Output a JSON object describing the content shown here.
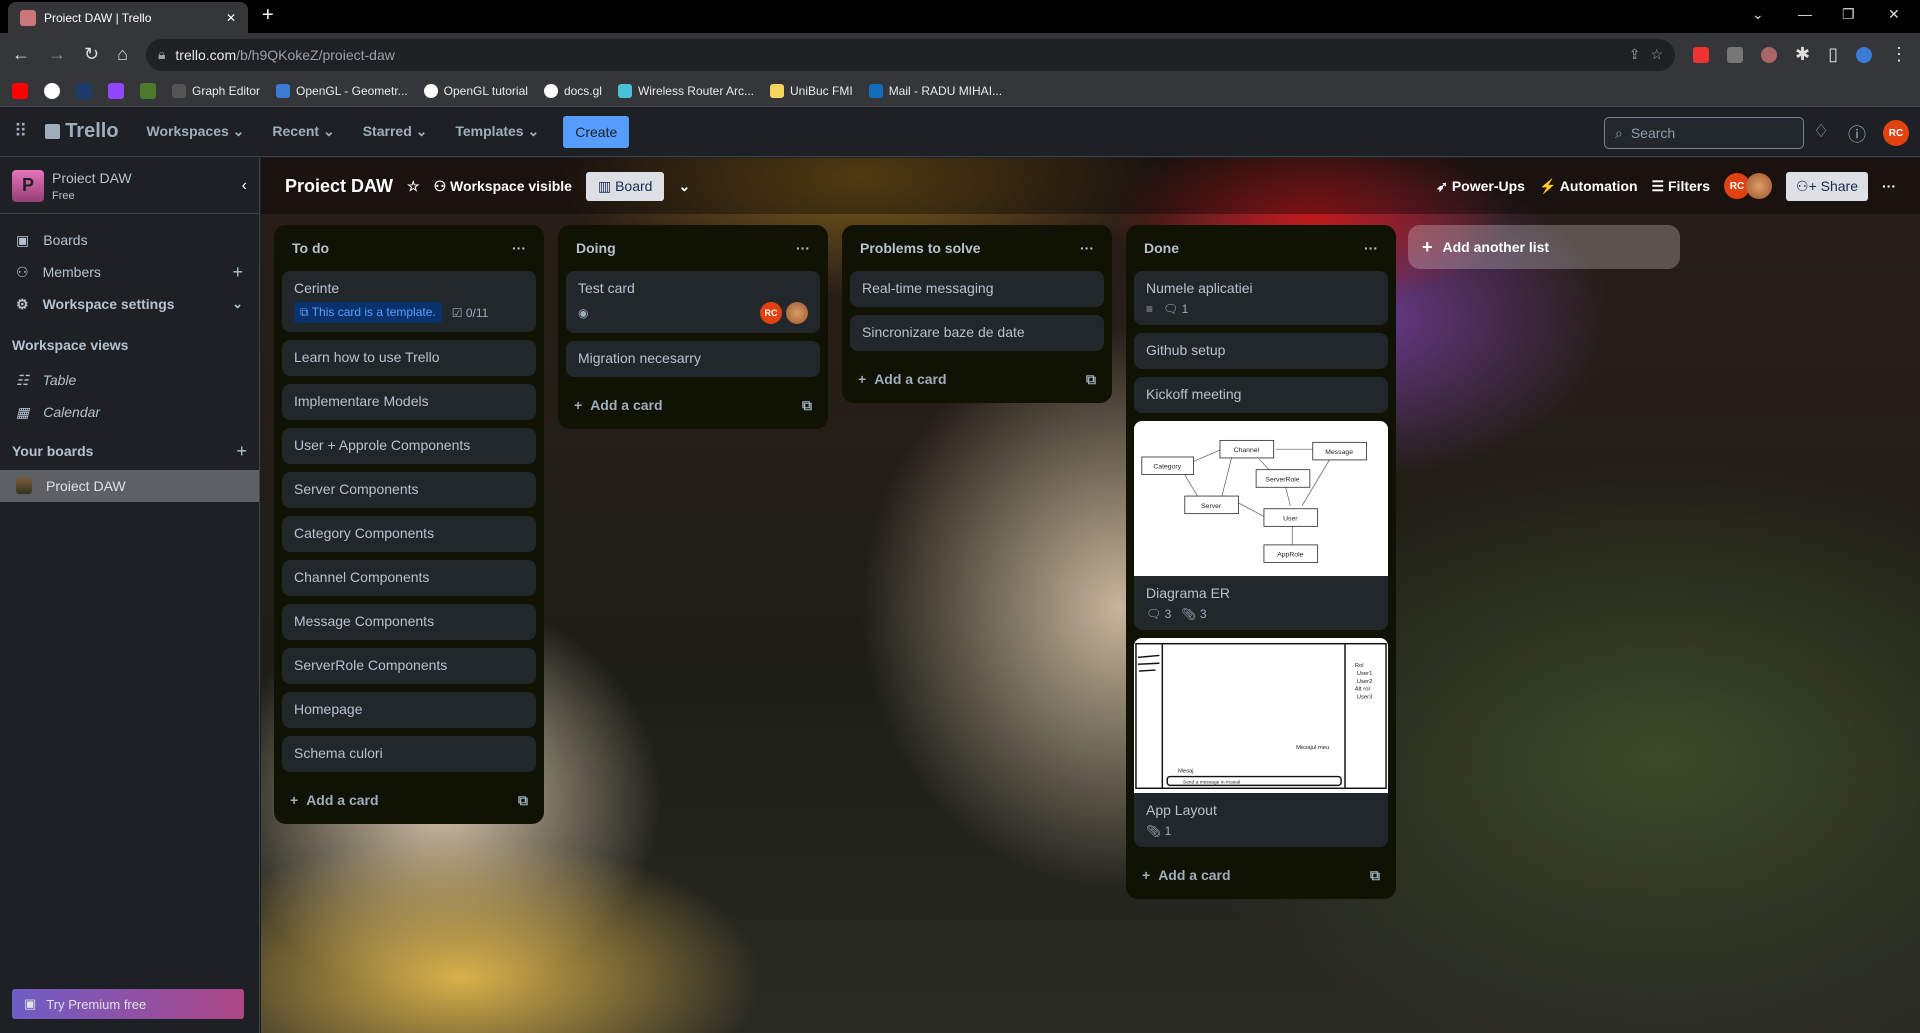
{
  "browser": {
    "tab_title": "Proiect DAW | Trello",
    "url_host": "trello.com",
    "url_path": "/b/h9QKokeZ/proiect-daw",
    "bookmarks": [
      "Graph Editor",
      "OpenGL - Geometr...",
      "OpenGL tutorial",
      "docs.gl",
      "Wireless Router Arc...",
      "UniBuc FMI",
      "Mail - RADU MIHAI..."
    ]
  },
  "header": {
    "logo": "Trello",
    "nav": [
      "Workspaces",
      "Recent",
      "Starred",
      "Templates"
    ],
    "create": "Create",
    "search_placeholder": "Search",
    "user_initials": "RC"
  },
  "sidebar": {
    "workspace_name": "Proiect DAW",
    "workspace_initial": "P",
    "plan": "Free",
    "items": [
      {
        "label": "Boards"
      },
      {
        "label": "Members"
      },
      {
        "label": "Workspace settings"
      }
    ],
    "views_heading": "Workspace views",
    "views": [
      {
        "label": "Table"
      },
      {
        "label": "Calendar"
      }
    ],
    "boards_heading": "Your boards",
    "boards": [
      {
        "label": "Proiect DAW"
      }
    ],
    "premium": "Try Premium free"
  },
  "board": {
    "title": "Proiect DAW",
    "visibility": "Workspace visible",
    "view": "Board",
    "powerups": "Power-Ups",
    "automation": "Automation",
    "filters": "Filters",
    "member_initials": "RC",
    "share": "Share",
    "add_list": "Add another list",
    "add_card": "Add a card"
  },
  "lists": [
    {
      "title": "To do",
      "cards": [
        "Cerinte",
        "Learn how to use Trello",
        "Implementare Models",
        "User + Approle Components",
        "Server Components",
        "Category Components",
        "Channel Components",
        "Message Components",
        "ServerRole Components",
        "Homepage",
        "Schema culori"
      ],
      "template_badge": "This card is a template.",
      "checklist": "0/11"
    },
    {
      "title": "Doing",
      "cards": [
        "Test card",
        "Migration necesarry"
      ],
      "test_initials": "RC"
    },
    {
      "title": "Problems to solve",
      "cards": [
        "Real-time messaging",
        "Sincronizare baze de date"
      ]
    },
    {
      "title": "Done",
      "cards": [
        "Numele aplicatiei",
        "Github setup",
        "Kickoff meeting",
        "Diagrama ER",
        "App Layout"
      ],
      "comments_1": "1",
      "er_comments": "3",
      "er_attachments": "3",
      "layout_attachments": "1",
      "er_entities": [
        "Category",
        "Channel",
        "Message",
        "ServerRole",
        "Server",
        "User",
        "AppRole"
      ],
      "layout_texts": [
        "Rol",
        "User1",
        "User2",
        "Alt rol",
        "User3",
        "Mesajul meu",
        "Mesaj",
        "Send a message in #canal"
      ]
    }
  ]
}
